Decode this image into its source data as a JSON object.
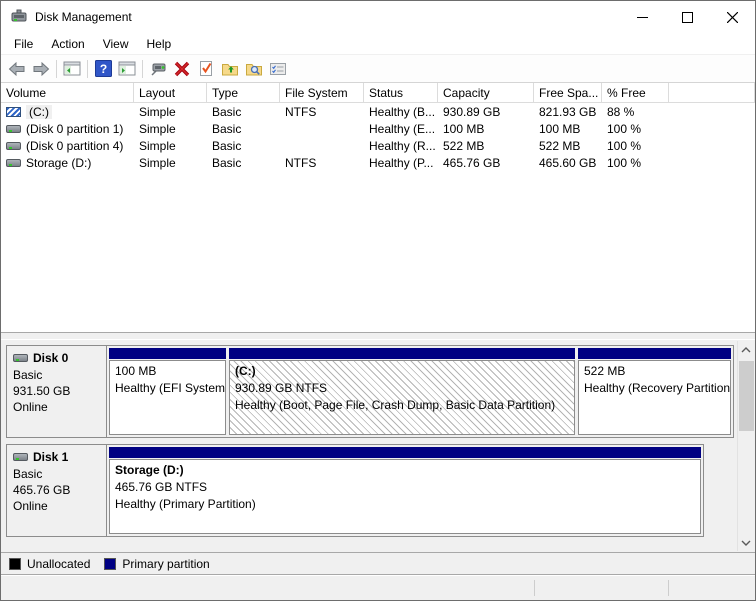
{
  "window": {
    "title": "Disk Management",
    "controls": {
      "minimize": "minimize",
      "maximize": "maximize",
      "close": "close"
    }
  },
  "menu": {
    "items": [
      "File",
      "Action",
      "View",
      "Help"
    ]
  },
  "toolbar": {
    "icons": [
      "back-arrow",
      "forward-arrow",
      "console-tree-toggle",
      "help",
      "action-pane-toggle",
      "display-device",
      "delete-volume",
      "check-document",
      "folder-up",
      "folder-explore",
      "checklist"
    ]
  },
  "volume_table": {
    "columns": [
      "Volume",
      "Layout",
      "Type",
      "File System",
      "Status",
      "Capacity",
      "Free Spa...",
      "% Free"
    ],
    "rows": [
      {
        "volume": "(C:)",
        "layout": "Simple",
        "type": "Basic",
        "fs": "NTFS",
        "status": "Healthy (B...",
        "capacity": "930.89 GB",
        "free": "821.93 GB",
        "pct": "88 %"
      },
      {
        "volume": "(Disk 0 partition 1)",
        "layout": "Simple",
        "type": "Basic",
        "fs": "",
        "status": "Healthy (E...",
        "capacity": "100 MB",
        "free": "100 MB",
        "pct": "100 %"
      },
      {
        "volume": "(Disk 0 partition 4)",
        "layout": "Simple",
        "type": "Basic",
        "fs": "",
        "status": "Healthy (R...",
        "capacity": "522 MB",
        "free": "522 MB",
        "pct": "100 %"
      },
      {
        "volume": "Storage (D:)",
        "layout": "Simple",
        "type": "Basic",
        "fs": "NTFS",
        "status": "Healthy (P...",
        "capacity": "465.76 GB",
        "free": "465.60 GB",
        "pct": "100 %"
      }
    ]
  },
  "disks": [
    {
      "name": "Disk 0",
      "kind": "Basic",
      "size": "931.50 GB",
      "status": "Online",
      "partitions": [
        {
          "name": "",
          "line2": "100 MB",
          "line3": "Healthy (EFI System"
        },
        {
          "name": "(C:)",
          "line2": "930.89 GB NTFS",
          "line3": "Healthy (Boot, Page File, Crash Dump, Basic Data Partition)"
        },
        {
          "name": "",
          "line2": "522 MB",
          "line3": "Healthy (Recovery Partition"
        }
      ]
    },
    {
      "name": "Disk 1",
      "kind": "Basic",
      "size": "465.76 GB",
      "status": "Online",
      "partitions": [
        {
          "name": "Storage  (D:)",
          "line2": "465.76 GB NTFS",
          "line3": "Healthy (Primary Partition)"
        }
      ]
    }
  ],
  "legend": [
    {
      "label": "Unallocated",
      "color": "#000000"
    },
    {
      "label": "Primary partition",
      "color": "#000082"
    }
  ],
  "colors": {
    "partition_bar": "#000082",
    "pane_bg": "#f0f0f0",
    "selection_hatch": "#b4b4b4"
  }
}
